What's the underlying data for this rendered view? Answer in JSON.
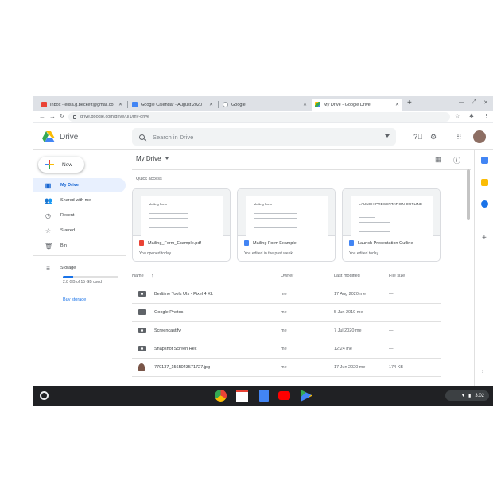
{
  "tabs": [
    {
      "label": "Inbox - elisa.g.beckett@gmail.co",
      "favicon": "gmail-icon"
    },
    {
      "label": "Google Calendar - August 2020",
      "favicon": "calendar-icon"
    },
    {
      "label": "Google",
      "favicon": "google-icon"
    },
    {
      "label": "My Drive - Google Drive",
      "favicon": "drive-icon",
      "active": true
    }
  ],
  "address": {
    "url": "drive.google.com/drive/u/1/my-drive"
  },
  "header": {
    "app_name": "Drive",
    "search_placeholder": "Search in Drive"
  },
  "nav": {
    "new_label": "New",
    "items": [
      {
        "label": "My Drive",
        "icon": "my-drive-icon",
        "active": true
      },
      {
        "label": "Shared with me",
        "icon": "people-icon"
      },
      {
        "label": "Recent",
        "icon": "clock-icon"
      },
      {
        "label": "Starred",
        "icon": "star-icon"
      },
      {
        "label": "Bin",
        "icon": "trash-icon"
      }
    ],
    "storage_label": "Storage",
    "storage_text": "2.8 GB of 15 GB used",
    "storage_fraction": 0.19,
    "buy_label": "Buy storage"
  },
  "main": {
    "title": "My Drive",
    "quick_access_label": "Quick access",
    "cards": [
      {
        "name": "Mailing_Form_Example.pdf",
        "sub": "You opened today",
        "type": "pdf",
        "doc_title": "Mailing Form"
      },
      {
        "name": "Mailing Form Example",
        "sub": "You edited in the past week",
        "type": "doc",
        "doc_title": "Mailing Form"
      },
      {
        "name": "Launch Presentation Outline",
        "sub": "You edited today",
        "type": "doc",
        "doc_title": "LAUNCH PRESENTATION OUTLINE"
      }
    ],
    "columns": {
      "name": "Name",
      "owner": "Owner",
      "modified": "Last modified",
      "size": "File size"
    },
    "rows": [
      {
        "name": "Bedtime Tools UIs - Pixel 4 XL",
        "owner": "me",
        "modified": "17 Aug 2020 me",
        "size": "—",
        "icon": "shared-folder-icon"
      },
      {
        "name": "Google Photos",
        "owner": "me",
        "modified": "5 Jun 2019 me",
        "size": "—",
        "icon": "folder-icon"
      },
      {
        "name": "Screencastify",
        "owner": "me",
        "modified": "7 Jul 2020 me",
        "size": "—",
        "icon": "shared-folder-icon"
      },
      {
        "name": "Snapshot Screen Rec",
        "owner": "me",
        "modified": "12:24 me",
        "size": "—",
        "icon": "shared-folder-icon"
      },
      {
        "name": "779137_1565043571727.jpg",
        "owner": "me",
        "modified": "17 Jun 2020 me",
        "size": "174 KB",
        "icon": "image-icon"
      }
    ]
  },
  "shelf": {
    "time": "3:02"
  },
  "colors": {
    "accent": "#1a73e8",
    "active_bg": "#e8f0fe",
    "shelf": "#202124"
  }
}
